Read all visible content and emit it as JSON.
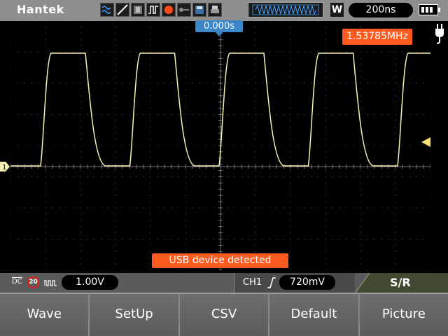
{
  "header": {
    "brand": "Hantek",
    "timebase": "200ns",
    "mode": "W",
    "icons": [
      "waveform-mode-icon",
      "persistence-icon",
      "gray-display-icon",
      "pulse-icon",
      "record-dot-icon",
      "key-icon",
      "save-icon",
      "print-icon",
      "memory-depth-bar",
      "battery-icon"
    ]
  },
  "plot": {
    "trigger_position": "0.000s",
    "frequency": "1.53785MHz",
    "usb_message": "USB device detected",
    "channel_marker": "1",
    "colors": {
      "trace": "#f7f2b3",
      "grid": "#5a5a5a",
      "orange_badge": "#ff5a1f",
      "blue_badge": "#3a86c8"
    }
  },
  "status": {
    "coupling": "DC",
    "bandwidth_limit": "20",
    "volt_div": "1.00V",
    "trigger_source": "CH1",
    "trigger_level": "720mV",
    "menu_title": "S/R"
  },
  "softkeys": [
    {
      "label": "Wave"
    },
    {
      "label": "SetUp"
    },
    {
      "label": "CSV"
    },
    {
      "label": "Default"
    },
    {
      "label": "Picture"
    }
  ]
}
